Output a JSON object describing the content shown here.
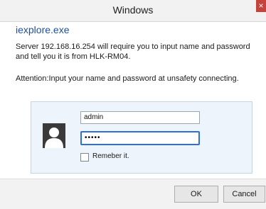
{
  "window": {
    "title": "Windows",
    "close_glyph": "×"
  },
  "app": {
    "name": "iexplore.exe"
  },
  "message": {
    "text": "Server 192.168.16.254 will require you to input name and password and tell you it is from HLK-RM04.",
    "attention": "Attention:Input your name and password at unsafety connecting."
  },
  "credentials": {
    "username_value": "admin",
    "password_mask": "•••••",
    "remember_label": "Remeber it.",
    "remember_checked": false,
    "avatar_icon": "user-avatar-icon"
  },
  "buttons": {
    "ok_label": "OK",
    "cancel_label": "Cancel"
  },
  "colors": {
    "title_bar": "#f2f2f2",
    "close_button": "#c4433c",
    "app_name": "#1c4f9a",
    "panel_bg": "#eef4fb",
    "focus_border": "#2f6fd6"
  }
}
